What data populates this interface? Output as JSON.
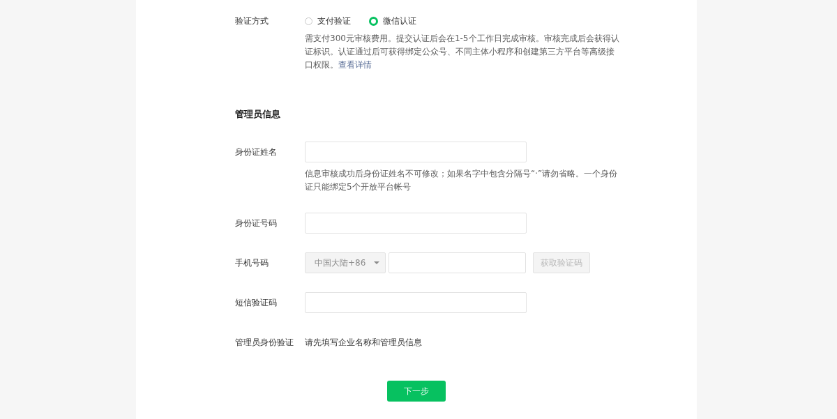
{
  "verification": {
    "label": "验证方式",
    "options": [
      {
        "label": "支付验证",
        "selected": false
      },
      {
        "label": "微信认证",
        "selected": true
      }
    ],
    "description": "需支付300元审核费用。提交认证后会在1-5个工作日完成审核。审核完成后会获得认证标识。认证通过后可获得绑定公众号、不同主体小程序和创建第三方平台等高级接口权限。",
    "link": "查看详情"
  },
  "section_title": "管理员信息",
  "fields": [
    {
      "kind": "input",
      "label": "身份证姓名",
      "hint": "信息审核成功后身份证姓名不可修改；如果名字中包含分隔号“·”请勿省略。一个身份证只能绑定5个开放平台帐号"
    },
    {
      "kind": "input",
      "label": "身份证号码"
    },
    {
      "kind": "phone",
      "label": "手机号码",
      "country": "中国大陆+86",
      "button": "获取验证码"
    },
    {
      "kind": "input",
      "label": "短信验证码"
    },
    {
      "kind": "text",
      "label": "管理员身份验证",
      "value": "请先填写企业名称和管理员信息"
    }
  ],
  "next_button": "下一步"
}
